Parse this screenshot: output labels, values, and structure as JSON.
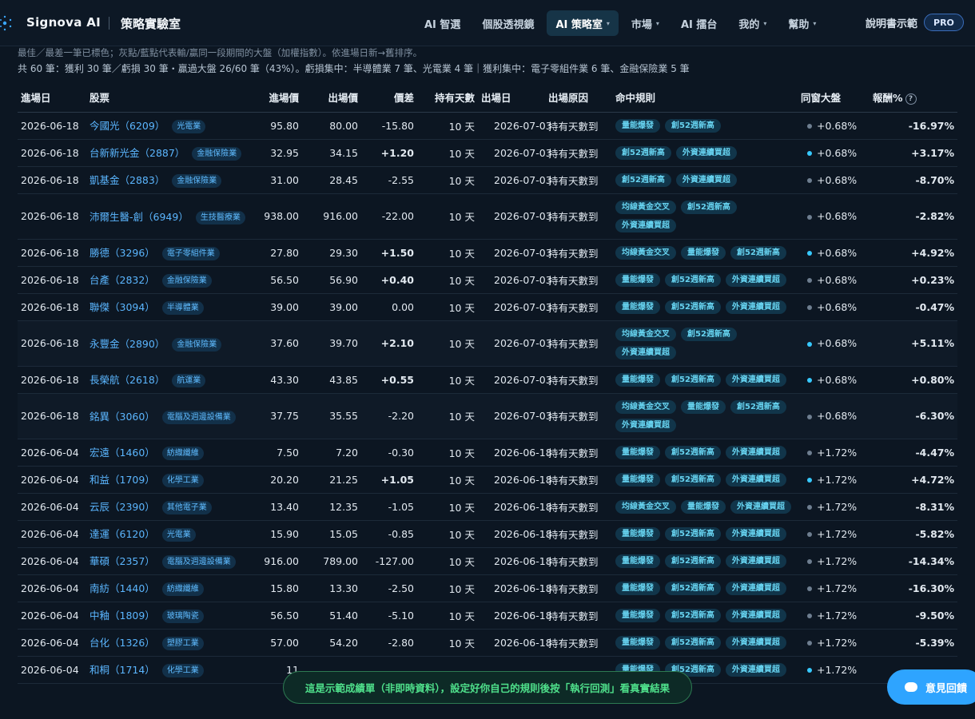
{
  "header": {
    "brand": "Signova AI",
    "subtitle": "策略實驗室",
    "nav": [
      {
        "label": "AI 智選",
        "caret": false,
        "active": false
      },
      {
        "label": "個股透視鏡",
        "caret": false,
        "active": false
      },
      {
        "label": "AI 策略室",
        "caret": true,
        "active": true
      },
      {
        "label": "市場",
        "caret": true,
        "active": false
      },
      {
        "label": "AI 擂台",
        "caret": false,
        "active": false
      },
      {
        "label": "我的",
        "caret": true,
        "active": false
      },
      {
        "label": "幫助",
        "caret": true,
        "active": false
      }
    ],
    "manual_link": "說明書示範",
    "pro_badge": "PRO"
  },
  "info": {
    "line1": "最佳／最差一筆已標色；灰點/藍點代表輸/贏同一段期間的大盤（加權指數）。依進場日新→舊排序。",
    "line2": "共 60 筆：獲利 30 筆／虧損 30 筆・贏過大盤 26/60 筆（43%）。虧損集中：半導體業 7 筆、光電業 4 筆｜獲利集中：電子零組件業 6 筆、金融保險業 5 筆"
  },
  "columns": {
    "entry_date": "進場日",
    "stock": "股票",
    "entry_price": "進場價",
    "exit_price": "出場價",
    "diff": "價差",
    "hold_days": "持有天數",
    "exit_date": "出場日",
    "exit_reason": "出場原因",
    "rules": "命中規則",
    "market": "同窗大盤",
    "return": "報酬%",
    "help": "?"
  },
  "rows": [
    {
      "entry": "2026-06-18",
      "name": "今國光（6209）",
      "ind": "光電業",
      "ep": "95.80",
      "xp": "80.00",
      "diff": "-15.80",
      "hold": "10 天",
      "exit": "2026-07-03",
      "reason": "持有天數到",
      "rules": [
        "量能爆發",
        "創52週新高"
      ],
      "beat": false,
      "mkt": "+0.68%",
      "ret": "-16.97%"
    },
    {
      "entry": "2026-06-18",
      "name": "台新新光金（2887）",
      "ind": "金融保險業",
      "ep": "32.95",
      "xp": "34.15",
      "diff": "+1.20",
      "hold": "10 天",
      "exit": "2026-07-03",
      "reason": "持有天數到",
      "rules": [
        "創52週新高",
        "外資連續買超"
      ],
      "beat": true,
      "mkt": "+0.68%",
      "ret": "+3.17%"
    },
    {
      "entry": "2026-06-18",
      "name": "凱基金（2883）",
      "ind": "金融保險業",
      "ep": "31.00",
      "xp": "28.45",
      "diff": "-2.55",
      "hold": "10 天",
      "exit": "2026-07-03",
      "reason": "持有天數到",
      "rules": [
        "創52週新高",
        "外資連續買超"
      ],
      "beat": false,
      "mkt": "+0.68%",
      "ret": "-8.70%"
    },
    {
      "entry": "2026-06-18",
      "name": "沛爾生醫-創（6949）",
      "ind": "生技醫療業",
      "ep": "938.00",
      "xp": "916.00",
      "diff": "-22.00",
      "hold": "10 天",
      "exit": "2026-07-03",
      "reason": "持有天數到",
      "rules": [
        "均線黃金交叉",
        "創52週新高",
        "外資連續買超"
      ],
      "beat": false,
      "mkt": "+0.68%",
      "ret": "-2.82%"
    },
    {
      "entry": "2026-06-18",
      "name": "勝德（3296）",
      "ind": "電子零組件業",
      "ep": "27.80",
      "xp": "29.30",
      "diff": "+1.50",
      "hold": "10 天",
      "exit": "2026-07-03",
      "reason": "持有天數到",
      "rules": [
        "均線黃金交叉",
        "量能爆發",
        "創52週新高"
      ],
      "beat": true,
      "mkt": "+0.68%",
      "ret": "+4.92%"
    },
    {
      "entry": "2026-06-18",
      "name": "台產（2832）",
      "ind": "金融保險業",
      "ep": "56.50",
      "xp": "56.90",
      "diff": "+0.40",
      "hold": "10 天",
      "exit": "2026-07-03",
      "reason": "持有天數到",
      "rules": [
        "量能爆發",
        "創52週新高",
        "外資連續買超"
      ],
      "beat": false,
      "mkt": "+0.68%",
      "ret": "+0.23%"
    },
    {
      "entry": "2026-06-18",
      "name": "聯傑（3094）",
      "ind": "半導體業",
      "ep": "39.00",
      "xp": "39.00",
      "diff": "0.00",
      "hold": "10 天",
      "exit": "2026-07-03",
      "reason": "持有天數到",
      "rules": [
        "量能爆發",
        "創52週新高",
        "外資連續買超"
      ],
      "beat": false,
      "mkt": "+0.68%",
      "ret": "-0.47%"
    },
    {
      "entry": "2026-06-18",
      "name": "永豐金（2890）",
      "ind": "金融保險業",
      "ep": "37.60",
      "xp": "39.70",
      "diff": "+2.10",
      "hold": "10 天",
      "exit": "2026-07-03",
      "reason": "持有天數到",
      "rules": [
        "均線黃金交叉",
        "創52週新高",
        "外資連續買超"
      ],
      "beat": true,
      "mkt": "+0.68%",
      "ret": "+5.11%"
    },
    {
      "entry": "2026-06-18",
      "name": "長榮航（2618）",
      "ind": "航運業",
      "ep": "43.30",
      "xp": "43.85",
      "diff": "+0.55",
      "hold": "10 天",
      "exit": "2026-07-03",
      "reason": "持有天數到",
      "rules": [
        "量能爆發",
        "創52週新高",
        "外資連續買超"
      ],
      "beat": true,
      "mkt": "+0.68%",
      "ret": "+0.80%"
    },
    {
      "entry": "2026-06-18",
      "name": "銘異（3060）",
      "ind": "電腦及週邊設備業",
      "ep": "37.75",
      "xp": "35.55",
      "diff": "-2.20",
      "hold": "10 天",
      "exit": "2026-07-03",
      "reason": "持有天數到",
      "rules": [
        "均線黃金交叉",
        "量能爆發",
        "創52週新高",
        "外資連續買超"
      ],
      "beat": false,
      "mkt": "+0.68%",
      "ret": "-6.30%"
    },
    {
      "entry": "2026-06-04",
      "name": "宏遠（1460）",
      "ind": "紡織纖維",
      "ep": "7.50",
      "xp": "7.20",
      "diff": "-0.30",
      "hold": "10 天",
      "exit": "2026-06-18",
      "reason": "持有天數到",
      "rules": [
        "量能爆發",
        "創52週新高",
        "外資連續買超"
      ],
      "beat": false,
      "mkt": "+1.72%",
      "ret": "-4.47%"
    },
    {
      "entry": "2026-06-04",
      "name": "和益（1709）",
      "ind": "化學工業",
      "ep": "20.20",
      "xp": "21.25",
      "diff": "+1.05",
      "hold": "10 天",
      "exit": "2026-06-18",
      "reason": "持有天數到",
      "rules": [
        "量能爆發",
        "創52週新高",
        "外資連續買超"
      ],
      "beat": true,
      "mkt": "+1.72%",
      "ret": "+4.72%"
    },
    {
      "entry": "2026-06-04",
      "name": "云辰（2390）",
      "ind": "其他電子業",
      "ep": "13.40",
      "xp": "12.35",
      "diff": "-1.05",
      "hold": "10 天",
      "exit": "2026-06-18",
      "reason": "持有天數到",
      "rules": [
        "均線黃金交叉",
        "量能爆發",
        "外資連續買超"
      ],
      "beat": false,
      "mkt": "+1.72%",
      "ret": "-8.31%"
    },
    {
      "entry": "2026-06-04",
      "name": "達運（6120）",
      "ind": "光電業",
      "ep": "15.90",
      "xp": "15.05",
      "diff": "-0.85",
      "hold": "10 天",
      "exit": "2026-06-18",
      "reason": "持有天數到",
      "rules": [
        "量能爆發",
        "創52週新高",
        "外資連續買超"
      ],
      "beat": false,
      "mkt": "+1.72%",
      "ret": "-5.82%"
    },
    {
      "entry": "2026-06-04",
      "name": "華碩（2357）",
      "ind": "電腦及週邊設備業",
      "ep": "916.00",
      "xp": "789.00",
      "diff": "-127.00",
      "hold": "10 天",
      "exit": "2026-06-18",
      "reason": "持有天數到",
      "rules": [
        "量能爆發",
        "創52週新高",
        "外資連續買超"
      ],
      "beat": false,
      "mkt": "+1.72%",
      "ret": "-14.34%"
    },
    {
      "entry": "2026-06-04",
      "name": "南紡（1440）",
      "ind": "紡織纖維",
      "ep": "15.80",
      "xp": "13.30",
      "diff": "-2.50",
      "hold": "10 天",
      "exit": "2026-06-18",
      "reason": "持有天數到",
      "rules": [
        "量能爆發",
        "創52週新高",
        "外資連續買超"
      ],
      "beat": false,
      "mkt": "+1.72%",
      "ret": "-16.30%"
    },
    {
      "entry": "2026-06-04",
      "name": "中釉（1809）",
      "ind": "玻璃陶瓷",
      "ep": "56.50",
      "xp": "51.40",
      "diff": "-5.10",
      "hold": "10 天",
      "exit": "2026-06-18",
      "reason": "持有天數到",
      "rules": [
        "量能爆發",
        "創52週新高",
        "外資連續買超"
      ],
      "beat": false,
      "mkt": "+1.72%",
      "ret": "-9.50%"
    },
    {
      "entry": "2026-06-04",
      "name": "台化（1326）",
      "ind": "塑膠工業",
      "ep": "57.00",
      "xp": "54.20",
      "diff": "-2.80",
      "hold": "10 天",
      "exit": "2026-06-18",
      "reason": "持有天數到",
      "rules": [
        "量能爆發",
        "創52週新高",
        "外資連續買超"
      ],
      "beat": false,
      "mkt": "+1.72%",
      "ret": "-5.39%"
    },
    {
      "entry": "2026-06-04",
      "name": "和桐（1714）",
      "ind": "化學工業",
      "ep": "11",
      "xp": "",
      "diff": "",
      "hold": "",
      "exit": "",
      "reason": "",
      "rules": [
        "量能爆發",
        "創52週新高",
        "外資連續買超"
      ],
      "beat": true,
      "mkt": "+1.72%",
      "ret": ""
    }
  ],
  "footer": {
    "banner": "這是示範成績單（非即時資料），設定好你自己的規則後按「執行回測」看真實結果",
    "feedback": "意見回饋"
  },
  "colors": {
    "background": "#0c1622",
    "accent": "#5bb6ff",
    "positive": "#ff5c68",
    "negative": "#37c46a",
    "rule_chip": "#66d2ef"
  }
}
